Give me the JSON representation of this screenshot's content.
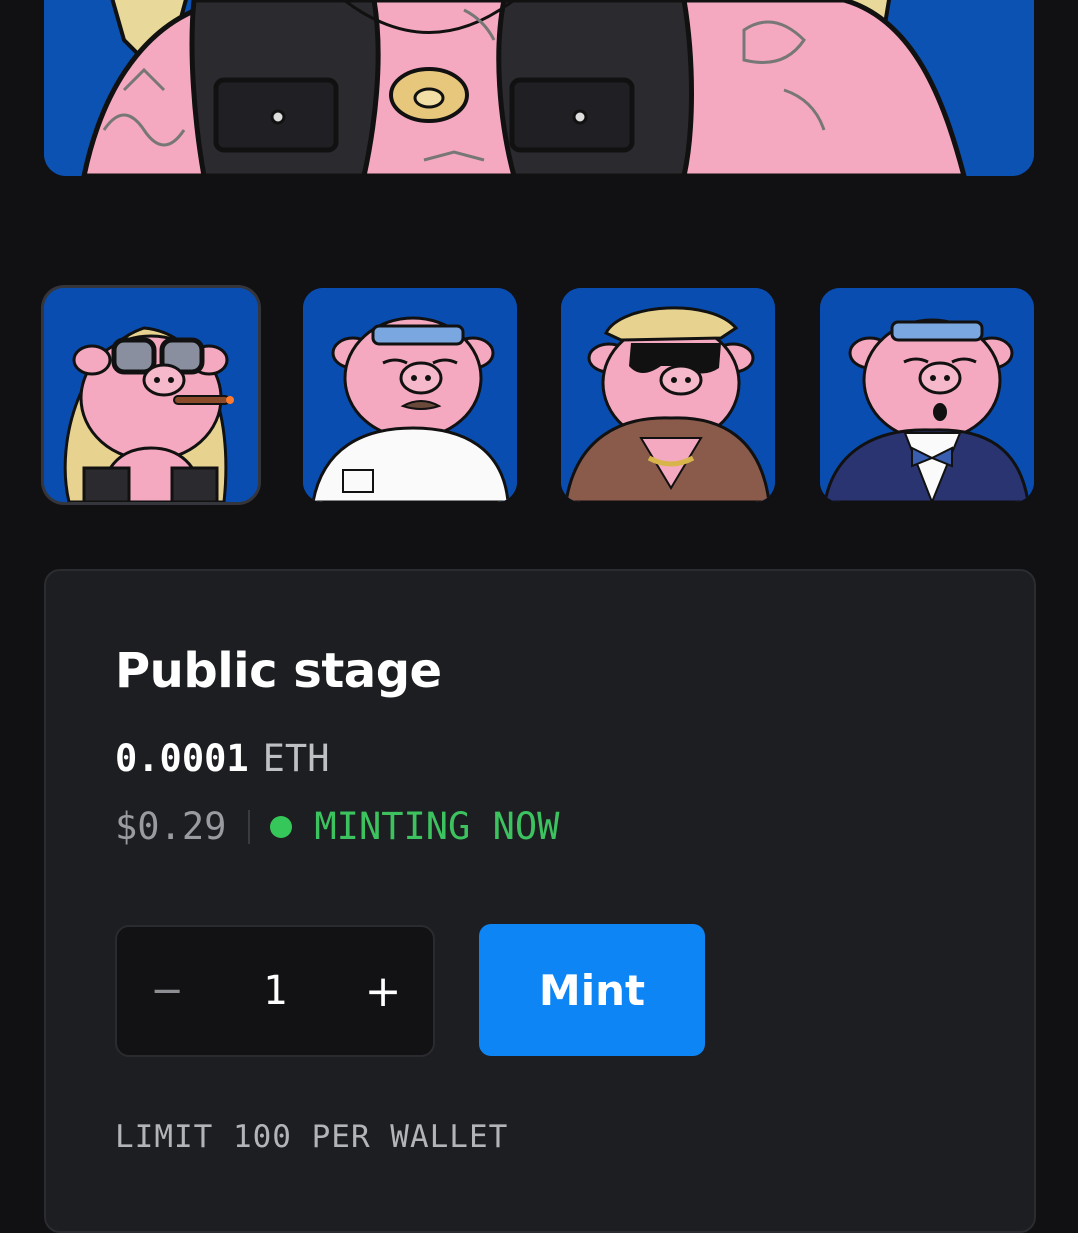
{
  "hero": {
    "alt": "Tattooed pig NFT artwork (detail)"
  },
  "thumbnails": [
    {
      "name": "pig-blonde-glasses-cigar",
      "selected": true
    },
    {
      "name": "pig-headband-mustache",
      "selected": false
    },
    {
      "name": "pig-sunglasses-fur-coat",
      "selected": false
    },
    {
      "name": "pig-headband-tuxedo",
      "selected": false
    }
  ],
  "stage": {
    "title": "Public stage",
    "price_value": "0.0001",
    "price_currency": "ETH",
    "usd_price": "$0.29",
    "status": "MINTING NOW",
    "quantity": "1",
    "decrement_label": "−",
    "increment_label": "+",
    "mint_label": "Mint",
    "limit_text": "LIMIT 100 PER WALLET"
  },
  "colors": {
    "background": "#111113",
    "card": "#1d1e21",
    "accent": "#0e85f5",
    "status_green": "#3cc35f",
    "art_blue": "#0b52b2",
    "pig_pink": "#f5a9c0"
  }
}
